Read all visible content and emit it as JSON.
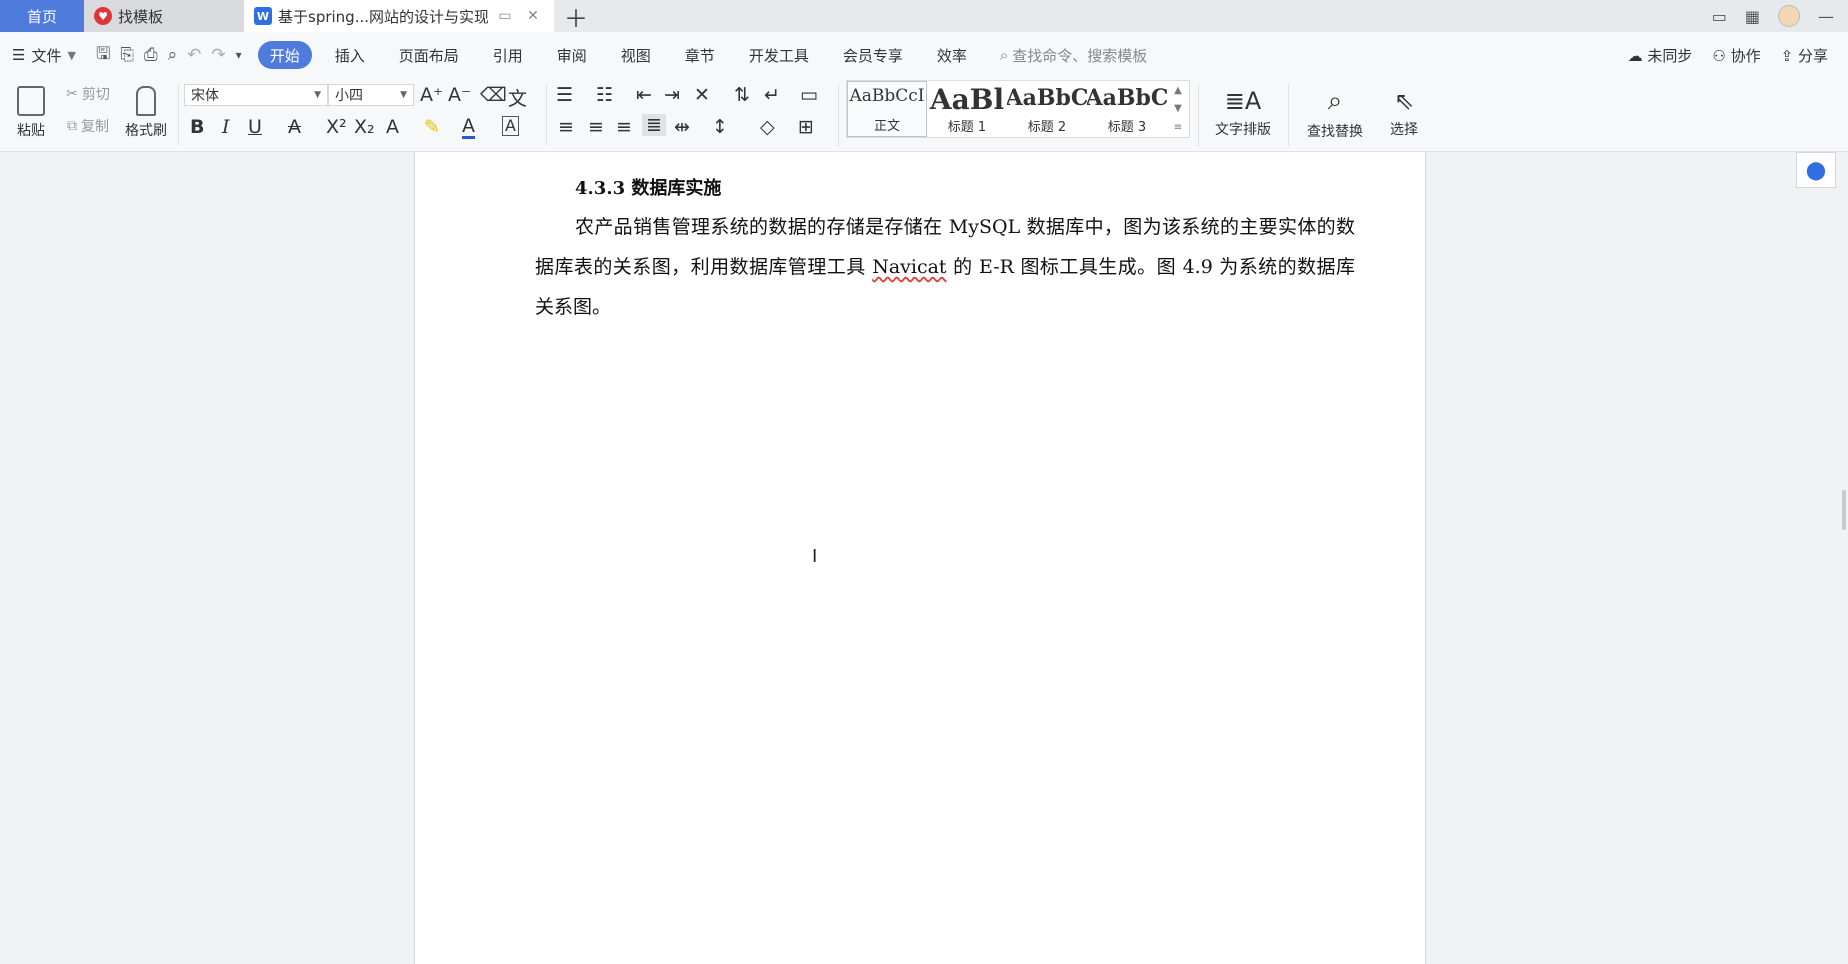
{
  "tabs": {
    "home": "首页",
    "template": "找模板",
    "document": "基于spring...网站的设计与实现"
  },
  "menu": {
    "file": "文件",
    "tabs": [
      "开始",
      "插入",
      "页面布局",
      "引用",
      "审阅",
      "视图",
      "章节",
      "开发工具",
      "会员专享",
      "效率"
    ],
    "search_placeholder": "查找命令、搜索模板",
    "sync": "未同步",
    "collab": "协作",
    "share": "分享"
  },
  "ribbon": {
    "paste": "粘贴",
    "cut": "剪切",
    "copy": "复制",
    "format_painter": "格式刷",
    "font_name": "宋体",
    "font_size": "小四",
    "styles": [
      {
        "sample": "AaBbCcI",
        "name": "正文"
      },
      {
        "sample": "AaBl",
        "name": "标题 1"
      },
      {
        "sample": "AaBbC",
        "name": "标题 2"
      },
      {
        "sample": "AaBbC",
        "name": "标题 3"
      }
    ],
    "text_layout": "文字排版",
    "find_replace": "查找替换",
    "select": "选择"
  },
  "document": {
    "heading": "4.3.3 数据库实施",
    "para_part1": "农产品销售管理系统的数据的存储是存储在 MySQL 数据库中，图为该系统的主要实体的数据库表的关系图，利用数据库管理工具 ",
    "para_term": "Navicat",
    "para_part2": " 的 E-R 图标工具生成。图 4.9 为系统的数据库关系图。"
  }
}
